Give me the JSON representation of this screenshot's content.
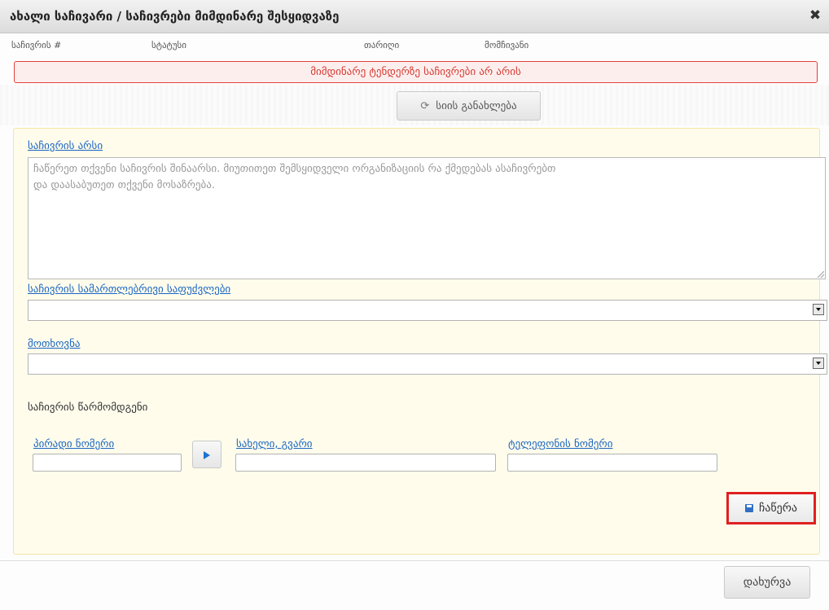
{
  "dialog": {
    "title": "ახალი საჩივარი / საჩივრები მიმდინარე შესყიდვაზე",
    "close_symbol": "✖"
  },
  "complaints_table": {
    "columns": [
      "საჩივრის #",
      "სტატუსი",
      "თარიღი",
      "მომჩივანი"
    ],
    "empty_message": "მიმდინარე ტენდერზე საჩივრები არ არის"
  },
  "refresh": {
    "icon": "refresh-icon",
    "icon_glyph": "⟳",
    "label": "სიის განახლება"
  },
  "form": {
    "essence_label": "საჩივრის არსი",
    "essence_placeholder": "ჩაწერეთ თქვენი საჩივრის შინაარსი. მიუთითეთ შემსყიდველი ორგანიზაციის რა ქმედებას ასაჩივრებთ\nდა დაასაბუთეთ თქვენი მოსაზრება.",
    "legal_basis_label": "საჩივრის სამართლებრივი საფუძვლები",
    "legal_basis_value": "",
    "request_label": "მოთხოვნა",
    "request_value": "",
    "representative_label": "საჩივრის წარმომდგენი",
    "personal_number_label": "პირადი ნომერი",
    "personal_number_value": "",
    "name_label": "სახელი, გვარი",
    "name_value": "",
    "phone_label": "ტელეფონის ნომერი",
    "phone_value": "",
    "save_label": "ჩაწერა"
  },
  "footer": {
    "close_label": "დახურვა"
  }
}
